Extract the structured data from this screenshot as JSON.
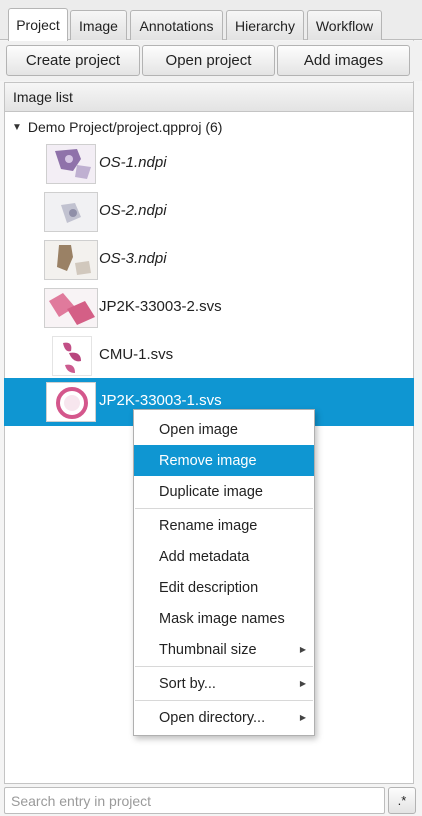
{
  "tabs": [
    {
      "label": "Project"
    },
    {
      "label": "Image"
    },
    {
      "label": "Annotations"
    },
    {
      "label": "Hierarchy"
    },
    {
      "label": "Workflow"
    }
  ],
  "toolbar": {
    "create_label": "Create project",
    "open_label": "Open project",
    "add_label": "Add images"
  },
  "list": {
    "header": "Image list",
    "root": "Demo Project/project.qpproj (6)",
    "items": [
      {
        "label": "OS-1.ndpi",
        "italic": true
      },
      {
        "label": "OS-2.ndpi",
        "italic": true
      },
      {
        "label": "OS-3.ndpi",
        "italic": true
      },
      {
        "label": "JP2K-33003-2.svs",
        "italic": false
      },
      {
        "label": "CMU-1.svs",
        "italic": false
      },
      {
        "label": "JP2K-33003-1.svs",
        "italic": false,
        "selected": true
      }
    ]
  },
  "context_menu": {
    "items": [
      {
        "label": "Open image"
      },
      {
        "label": "Remove image",
        "highlighted": true
      },
      {
        "label": "Duplicate image"
      },
      {
        "label": "Rename image"
      },
      {
        "label": "Add metadata"
      },
      {
        "label": "Edit description"
      },
      {
        "label": "Mask image names"
      },
      {
        "label": "Thumbnail size",
        "submenu": true
      },
      {
        "label": "Sort by...",
        "submenu": true
      },
      {
        "label": "Open directory...",
        "submenu": true
      }
    ]
  },
  "search": {
    "placeholder": "Search entry in project",
    "regex_label": ".*"
  },
  "colors": {
    "selection": "#0f96d2"
  }
}
